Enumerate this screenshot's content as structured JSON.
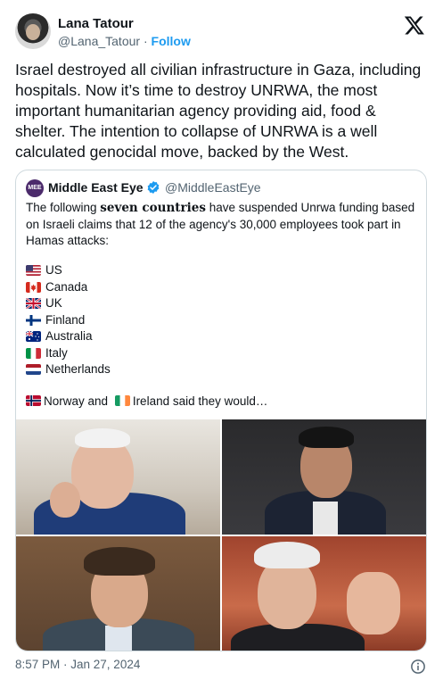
{
  "author": {
    "name": "Lana Tatour",
    "handle": "@Lana_Tatour",
    "separator": " · ",
    "follow_label": "Follow"
  },
  "tweet": {
    "text": "Israel destroyed all civilian infrastructure in Gaza, including hospitals. Now it’s time to destroy UNRWA, the most important humanitarian agency providing aid, food & shelter. The intention to collapse of UNRWA is a well calculated genocidal move, backed by the West."
  },
  "quoted": {
    "avatar_text": "MEE",
    "name": "Middle East Eye",
    "handle": "@MiddleEastEye",
    "text_before": "The following ",
    "text_bold": "seven countries",
    "text_after": " have suspended Unrwa funding based on Israeli claims that 12 of the agency's 30,000 employees took part in Hamas attacks:",
    "countries": [
      "US",
      "Canada",
      "UK",
      "Finland",
      "Australia",
      "Italy",
      "Netherlands"
    ],
    "closing_norway": "Norway and",
    "closing_ireland": "Ireland said they would…"
  },
  "footer": {
    "timestamp": "8:57 PM · Jan 27, 2024"
  },
  "colors": {
    "accent": "#1d9bf0",
    "secondary_text": "#536471",
    "border": "#cfd9de"
  },
  "icons": [
    "x-logo-icon",
    "verified-badge-icon",
    "info-icon"
  ]
}
